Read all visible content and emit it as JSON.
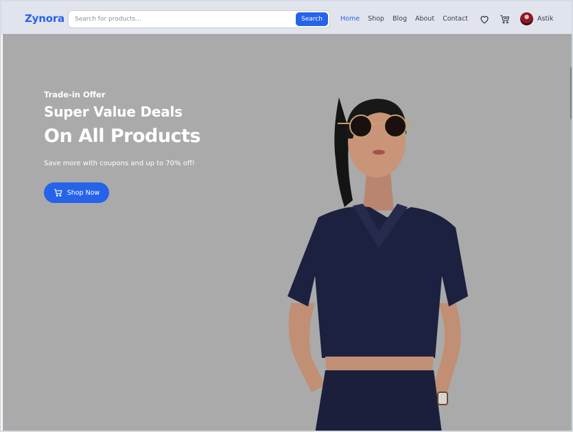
{
  "brand": {
    "name": "Zynora",
    "accent": "#2563eb"
  },
  "search": {
    "placeholder": "Search for products...",
    "button_label": "Search"
  },
  "nav": {
    "links": [
      {
        "label": "Home",
        "active": true
      },
      {
        "label": "Shop",
        "active": false
      },
      {
        "label": "Blog",
        "active": false
      },
      {
        "label": "About",
        "active": false
      },
      {
        "label": "Contact",
        "active": false
      }
    ],
    "icons": [
      "heart-icon",
      "cart-icon"
    ],
    "user_name": "Astik"
  },
  "hero": {
    "eyebrow": "Trade-in Offer",
    "headline_1": "Super Value Deals",
    "headline_2": "On All Products",
    "subtext": "Save more with coupons and up to 70% off!",
    "cta_label": "Shop Now",
    "background": "#aaaaaa"
  }
}
